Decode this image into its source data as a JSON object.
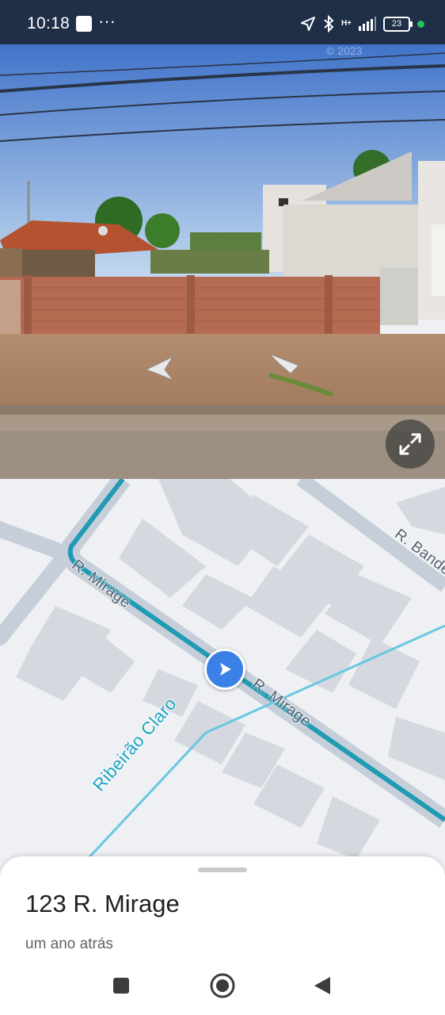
{
  "status_bar": {
    "time": "10:18",
    "app_icon": "app-notification-icon",
    "more": "···",
    "icons": [
      "location-arrow-icon",
      "bluetooth-icon",
      "signal-icon"
    ],
    "network": "H+",
    "battery": "23",
    "privacy_dot_color": "#20c35b"
  },
  "street_view": {
    "watermark": "© 2023",
    "nav_arrows": [
      "arrow-left-icon",
      "arrow-right-icon"
    ],
    "expand_icon": "expand-icon"
  },
  "map": {
    "streets": [
      "R. Mirage",
      "R. Mirage",
      "R. Bande"
    ],
    "waterway": "Ribeirão Claro",
    "route_color": "#1f9bb4",
    "locator_color": "#3b80e6"
  },
  "place": {
    "title": "123 R. Mirage",
    "subtitle": "um ano atrás"
  },
  "nav_bar": [
    "recents-square-icon",
    "home-circle-icon",
    "back-triangle-icon"
  ]
}
